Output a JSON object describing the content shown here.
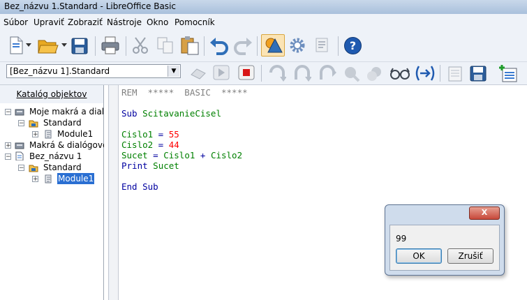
{
  "window": {
    "title": "Bez_názvu 1.Standard - LibreOffice Basic"
  },
  "menu": [
    {
      "label": "Súbor"
    },
    {
      "label": "Upraviť"
    },
    {
      "label": "Zobraziť"
    },
    {
      "label": "Nástroje"
    },
    {
      "label": "Okno"
    },
    {
      "label": "Pomocník"
    }
  ],
  "toolbar2": {
    "library_value": "[Bez_názvu 1].Standard"
  },
  "catalog": {
    "title": "Katalóg objektov",
    "items": [
      {
        "label": "Moje makrá a dialó"
      },
      {
        "label": "Standard"
      },
      {
        "label": "Module1"
      },
      {
        "label": "Makrá & dialógove"
      },
      {
        "label": "Bez_názvu 1"
      },
      {
        "label": "Standard"
      },
      {
        "label": "Module1"
      }
    ]
  },
  "code": {
    "l1": {
      "a": "REM",
      "b": "  *****  BASIC  *****"
    },
    "l2": {
      "a": "Sub",
      "b": " ScitavanieCisel"
    },
    "l3": {
      "a": "Cislo1",
      "b": " = ",
      "c": "55"
    },
    "l4": {
      "a": "Cislo2",
      "b": " = ",
      "c": "44"
    },
    "l5": {
      "a": "Sucet",
      "b": " = ",
      "c": "Cislo1",
      "d": " + ",
      "e": "Cislo2"
    },
    "l6": {
      "a": "Print",
      "b": " ",
      "c": "Sucet"
    },
    "l7": {
      "a": "End Sub"
    }
  },
  "dialog": {
    "close_label": "X",
    "message": "99",
    "ok_label": "OK",
    "cancel_label": "Zrušiť"
  },
  "colors": {
    "keyword": "#0000a0",
    "identifier": "#008000",
    "number": "#ff0000",
    "selection": "#2a6fd2"
  }
}
